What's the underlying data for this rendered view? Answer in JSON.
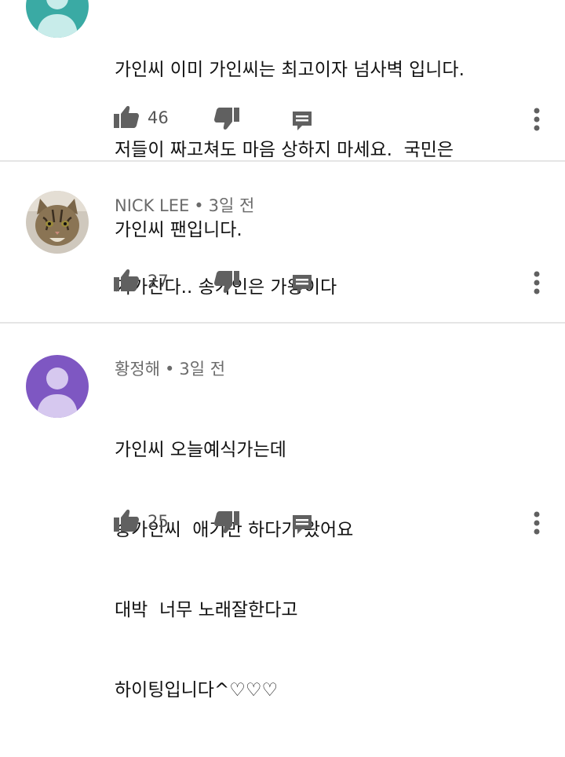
{
  "comments": [
    {
      "author": "",
      "time": "",
      "avatar_color": "#3aaaa4",
      "lines": [
        "가인씨 이미 가인씨는 최고이자 넘사벽 입니다.",
        "저들이 짜고쳐도 마음 상하지 마세요.  국민은",
        "가인씨 팬입니다."
      ],
      "likes": "46"
    },
    {
      "author": "NICK LEE",
      "separator": "•",
      "time": "3일 전",
      "avatar_kind": "cat-photo",
      "lines": [
        "기가찬다.. 송가인은 가왕이다"
      ],
      "likes": "27"
    },
    {
      "author": "황정해",
      "separator": "•",
      "time": "3일 전",
      "avatar_color": "#7e57c2",
      "lines": [
        "가인씨 오늘예식가는데",
        "송가인씨  애기만 하다가 왔어요",
        "대박  너무 노래잘한다고",
        "하이팅입니다^♡♡♡"
      ],
      "likes": "25"
    }
  ],
  "icons": {
    "like": "thumb-up-icon",
    "dislike": "thumb-down-icon",
    "reply": "reply-comment-icon",
    "more": "more-vert-icon"
  },
  "colors": {
    "icon": "#606060",
    "text": "#111111",
    "meta": "#6b6b6b",
    "divider": "#e5e5e5"
  }
}
